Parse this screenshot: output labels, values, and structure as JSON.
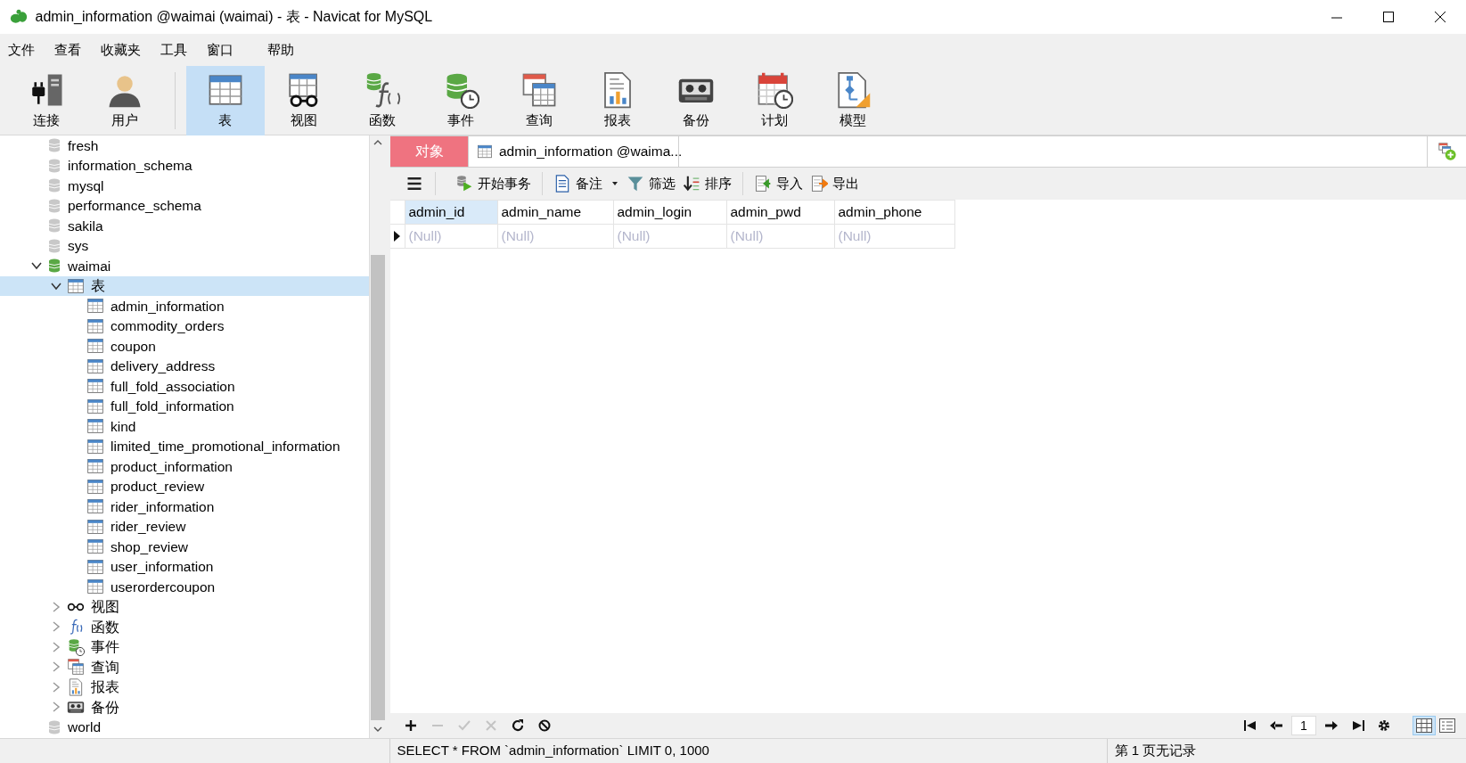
{
  "window": {
    "title": "admin_information @waimai (waimai) - 表 - Navicat for MySQL"
  },
  "menu": [
    "文件",
    "查看",
    "收藏夹",
    "工具",
    "窗口",
    "帮助"
  ],
  "toolbar": [
    {
      "kind": "connect",
      "label": "连接",
      "selected": false
    },
    {
      "kind": "user",
      "label": "用户",
      "selected": false
    },
    {
      "kind": "table",
      "label": "表",
      "selected": true
    },
    {
      "kind": "view",
      "label": "视图",
      "selected": false
    },
    {
      "kind": "function",
      "label": "函数",
      "selected": false
    },
    {
      "kind": "event",
      "label": "事件",
      "selected": false
    },
    {
      "kind": "query",
      "label": "查询",
      "selected": false
    },
    {
      "kind": "report",
      "label": "报表",
      "selected": false
    },
    {
      "kind": "backup",
      "label": "备份",
      "selected": false
    },
    {
      "kind": "schedule",
      "label": "计划",
      "selected": false
    },
    {
      "kind": "model",
      "label": "模型",
      "selected": false
    }
  ],
  "tree": [
    {
      "kind": "database",
      "label": "fresh",
      "opened": false,
      "selected": false
    },
    {
      "kind": "database",
      "label": "information_schema",
      "opened": false,
      "selected": false
    },
    {
      "kind": "database",
      "label": "mysql",
      "opened": false,
      "selected": false
    },
    {
      "kind": "database",
      "label": "performance_schema",
      "opened": false,
      "selected": false
    },
    {
      "kind": "database",
      "label": "sakila",
      "opened": false,
      "selected": false
    },
    {
      "kind": "database",
      "label": "sys",
      "opened": false,
      "selected": false
    },
    {
      "kind": "database",
      "label": "waimai",
      "opened": true,
      "expanded": true,
      "selected": false,
      "children": [
        {
          "kind": "tables",
          "label": "表",
          "expanded": true,
          "selected": true,
          "children": [
            {
              "kind": "table",
              "label": "admin_information",
              "selected": false
            },
            {
              "kind": "table",
              "label": "commodity_orders",
              "selected": false
            },
            {
              "kind": "table",
              "label": "coupon",
              "selected": false
            },
            {
              "kind": "table",
              "label": "delivery_address",
              "selected": false
            },
            {
              "kind": "table",
              "label": "full_fold_association",
              "selected": false
            },
            {
              "kind": "table",
              "label": "full_fold_information",
              "selected": false
            },
            {
              "kind": "table",
              "label": "kind",
              "selected": false
            },
            {
              "kind": "table",
              "label": "limited_time_promotional_information",
              "selected": false
            },
            {
              "kind": "table",
              "label": "product_information",
              "selected": false
            },
            {
              "kind": "table",
              "label": "product_review",
              "selected": false
            },
            {
              "kind": "table",
              "label": "rider_information",
              "selected": false
            },
            {
              "kind": "table",
              "label": "rider_review",
              "selected": false
            },
            {
              "kind": "table",
              "label": "shop_review",
              "selected": false
            },
            {
              "kind": "table",
              "label": "user_information",
              "selected": false
            },
            {
              "kind": "table",
              "label": "userordercoupon",
              "selected": false
            }
          ]
        },
        {
          "kind": "views",
          "label": "视图",
          "expanded": false,
          "selected": false
        },
        {
          "kind": "functions",
          "label": "函数",
          "expanded": false,
          "selected": false
        },
        {
          "kind": "events",
          "label": "事件",
          "expanded": false,
          "selected": false
        },
        {
          "kind": "queries",
          "label": "查询",
          "expanded": false,
          "selected": false
        },
        {
          "kind": "reports",
          "label": "报表",
          "expanded": false,
          "selected": false
        },
        {
          "kind": "backups",
          "label": "备份",
          "expanded": false,
          "selected": false
        }
      ]
    },
    {
      "kind": "database",
      "label": "world",
      "opened": false,
      "selected": false
    }
  ],
  "tabs": [
    {
      "kind": "objects",
      "label": "对象",
      "selected": false
    },
    {
      "kind": "table",
      "label": "admin_information @waima...",
      "selected": true
    }
  ],
  "data_toolbar": [
    {
      "kind": "menu"
    },
    {
      "kind": "transaction",
      "label": "开始事务"
    },
    {
      "kind": "note",
      "label": "备注",
      "dropdown": true
    },
    {
      "kind": "filter",
      "label": "筛选"
    },
    {
      "kind": "sort",
      "label": "排序"
    },
    {
      "kind": "import",
      "label": "导入"
    },
    {
      "kind": "export",
      "label": "导出"
    }
  ],
  "grid": {
    "columns": [
      {
        "label": "admin_id",
        "selected": true
      },
      {
        "label": "admin_name",
        "selected": false
      },
      {
        "label": "admin_login",
        "selected": false
      },
      {
        "label": "admin_pwd",
        "selected": false
      },
      {
        "label": "admin_phone",
        "selected": false
      }
    ],
    "rows": [
      {
        "current": true,
        "cells": [
          "(Null)",
          "(Null)",
          "(Null)",
          "(Null)",
          "(Null)"
        ]
      }
    ]
  },
  "record_buttons": [
    {
      "kind": "add",
      "disabled": false
    },
    {
      "kind": "remove",
      "disabled": true
    },
    {
      "kind": "apply",
      "disabled": true
    },
    {
      "kind": "discard",
      "disabled": true
    },
    {
      "kind": "refresh",
      "disabled": false
    },
    {
      "kind": "stop",
      "disabled": false
    }
  ],
  "pager": {
    "page": "1"
  },
  "view_modes": [
    {
      "kind": "grid",
      "selected": true
    },
    {
      "kind": "form",
      "selected": false
    }
  ],
  "status_bar": {
    "sql": "SELECT * FROM `admin_information` LIMIT 0, 1000",
    "page_info": "第 1 页无记录"
  }
}
